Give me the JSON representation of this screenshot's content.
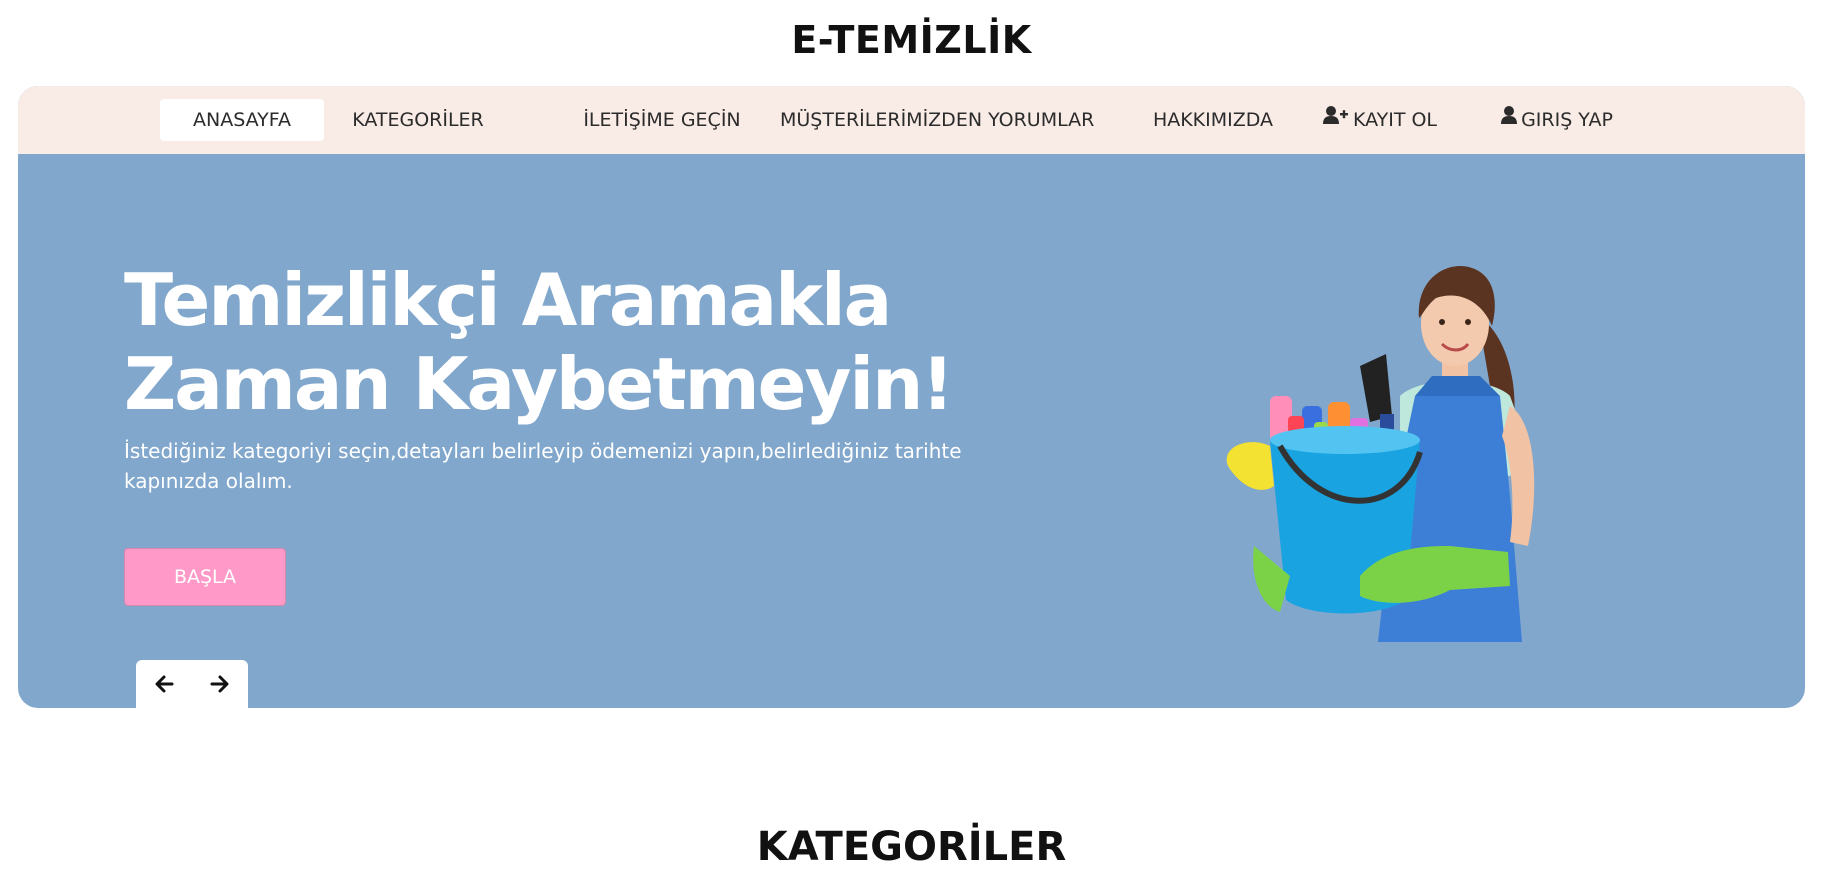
{
  "header": {
    "site_title": "E-TEMİZLİK"
  },
  "nav": {
    "items": [
      {
        "label": "ANASAYFA",
        "active": true
      },
      {
        "label": "KATEGORİLER"
      },
      {
        "label": "İLETİŞİME GEÇİN"
      },
      {
        "label": "MÜŞTERİLERİMİZDEN YORUMLAR"
      },
      {
        "label": "HAKKIMIZDA"
      },
      {
        "label": "KAYIT OL",
        "icon": "user-plus-icon"
      },
      {
        "label": "GIRIŞ YAP",
        "icon": "user-icon"
      }
    ]
  },
  "hero": {
    "heading_line1": "Temizlikçi Aramakla",
    "heading_line2": "Zaman Kaybetmeyin!",
    "subtext": "İstediğiniz kategoriyi seçin,detayları belirleyip ödemenizi yapın,belirlediğiniz tarihte kapınızda olalım.",
    "button_label": "BAŞLA",
    "image_icon": "cleaning-woman-illustration"
  },
  "slider": {
    "prev_icon": "arrow-left-icon",
    "next_icon": "arrow-right-icon"
  },
  "sections": {
    "categories_title": "KATEGORİLER"
  },
  "colors": {
    "nav_bg": "#f9ebe6",
    "hero_bg": "#81a7cc",
    "button_bg": "#ff99c8",
    "text_dark": "#111111",
    "text_light": "#ffffff"
  }
}
